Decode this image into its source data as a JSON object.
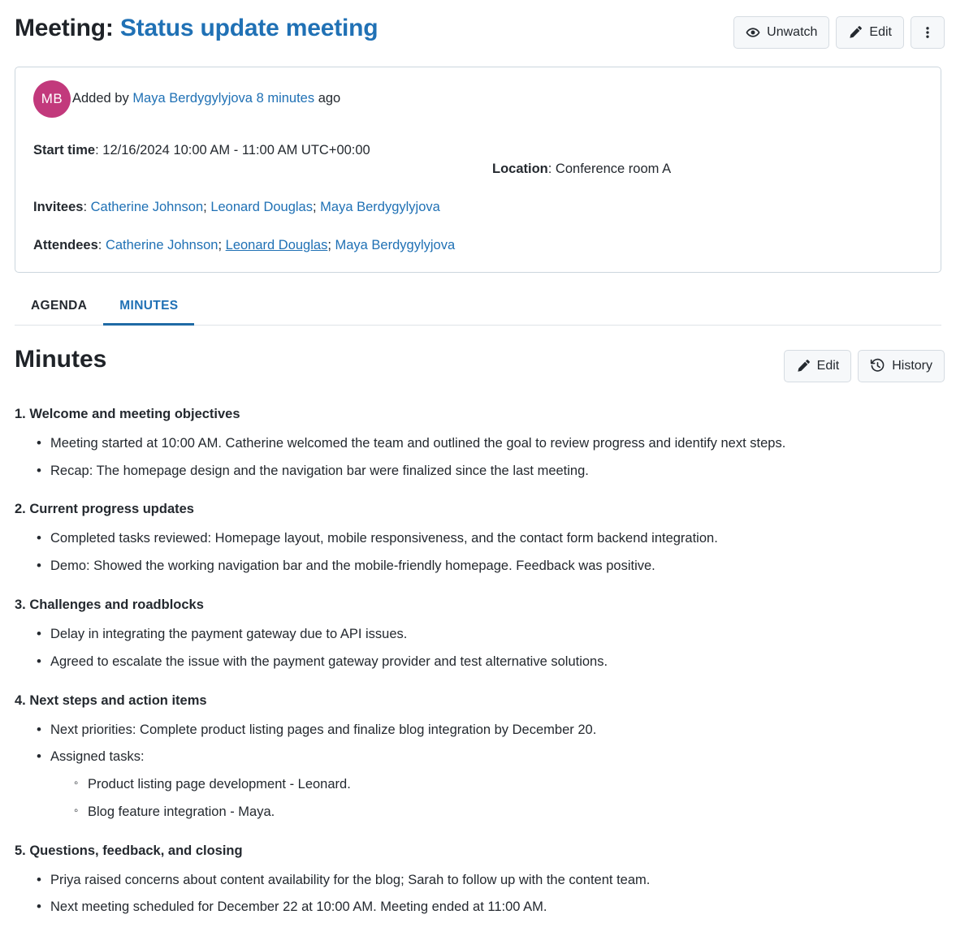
{
  "header": {
    "title_prefix": "Meeting:",
    "subject": "Status update meeting",
    "actions": {
      "unwatch_label": "Unwatch",
      "edit_label": "Edit",
      "more_label": "⋮"
    }
  },
  "info_card": {
    "avatar_initials": "MB",
    "added_prefix": "Added by ",
    "added_author": "Maya Berdygylyjova",
    "added_time": "8 minutes",
    "added_suffix": " ago",
    "start_time_label": "Start time",
    "start_time_value": "12/16/2024 10:00 AM - 11:00 AM UTC+00:00",
    "location_label": "Location",
    "location_value": "Conference room A",
    "invitees_label": "Invitees",
    "invitees": [
      "Catherine Johnson",
      "Leonard Douglas",
      "Maya Berdygylyjova"
    ],
    "attendees_label": "Attendees",
    "attendees": [
      "Catherine Johnson",
      "Leonard Douglas",
      "Maya Berdygylyjova"
    ],
    "separator": "; "
  },
  "tabs": [
    {
      "label": "AGENDA",
      "active": false
    },
    {
      "label": "MINUTES",
      "active": true
    }
  ],
  "minutes": {
    "heading": "Minutes",
    "edit_label": "Edit",
    "history_label": "History",
    "sections": [
      {
        "title": "1. Welcome and meeting objectives",
        "bullets": [
          "Meeting started at 10:00 AM. Catherine welcomed the team and outlined the goal to review progress and identify next steps.",
          "Recap: The homepage design and the navigation bar were finalized since the last meeting."
        ]
      },
      {
        "title": "2. Current progress updates",
        "bullets": [
          "Completed tasks reviewed: Homepage layout, mobile responsiveness, and the contact form backend integration.",
          "Demo: Showed the working navigation bar and the mobile-friendly homepage. Feedback was positive."
        ]
      },
      {
        "title": "3. Challenges and roadblocks",
        "bullets": [
          "Delay in integrating the payment gateway due to API issues.",
          "Agreed to escalate the issue with the payment gateway provider and test alternative solutions."
        ]
      },
      {
        "title": "4. Next steps and action items",
        "bullets": [
          "Next priorities: Complete product listing pages and finalize blog integration by December 20.",
          "Assigned tasks:"
        ],
        "sub_bullets": [
          "Product listing page development - Leonard.",
          "Blog feature integration - Maya."
        ]
      },
      {
        "title": "5. Questions, feedback, and closing",
        "bullets": [
          "Priya raised concerns about content availability for the blog; Sarah to follow up with the content team.",
          "Next meeting scheduled for December 22 at 10:00 AM. Meeting ended at 11:00 AM."
        ]
      }
    ]
  },
  "colors": {
    "link": "#2071b5",
    "avatar": "#c2397c",
    "tab_active": "#1f6aa5",
    "card_border": "#ccd6de",
    "button_bg": "#f6f8fa"
  }
}
